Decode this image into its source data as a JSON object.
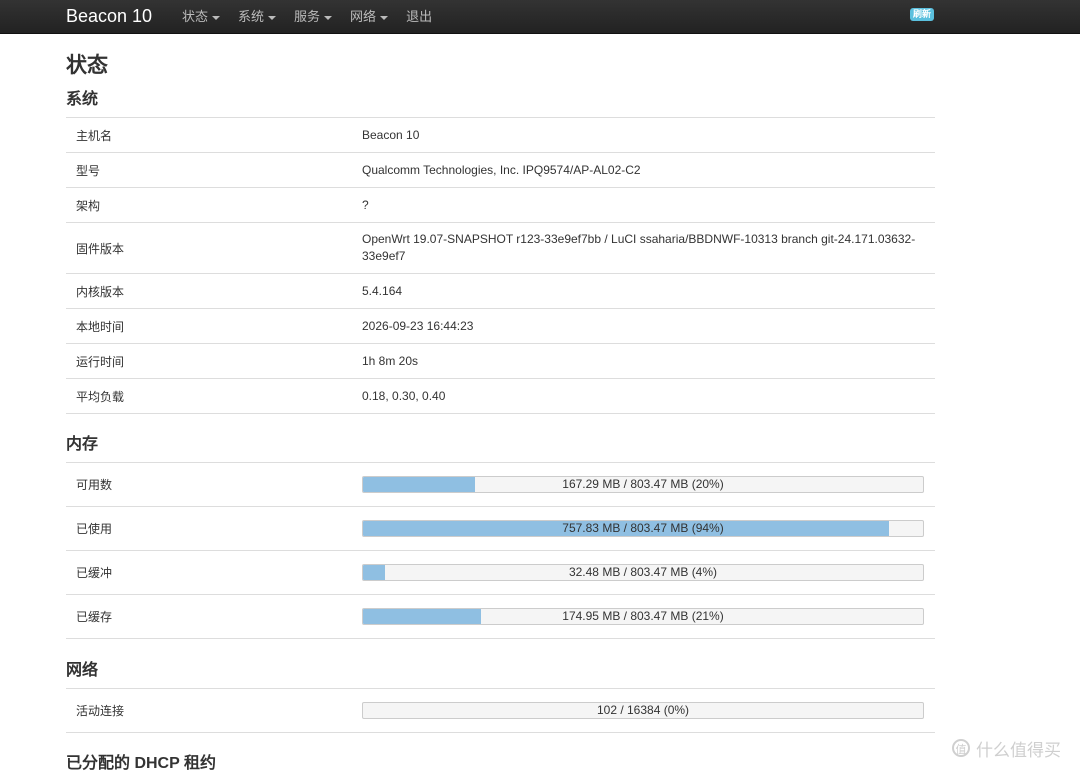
{
  "navbar": {
    "brand": "Beacon 10",
    "menu": [
      {
        "label": "状态",
        "dropdown": true
      },
      {
        "label": "系统",
        "dropdown": true
      },
      {
        "label": "服务",
        "dropdown": true
      },
      {
        "label": "网络",
        "dropdown": true
      },
      {
        "label": "退出",
        "dropdown": false
      }
    ],
    "refresh_badge": "刷新"
  },
  "page_title": "状态",
  "system": {
    "title": "系统",
    "rows": [
      {
        "label": "主机名",
        "value": "Beacon 10"
      },
      {
        "label": "型号",
        "value": "Qualcomm Technologies, Inc. IPQ9574/AP-AL02-C2"
      },
      {
        "label": "架构",
        "value": "?"
      },
      {
        "label": "固件版本",
        "value": "OpenWrt 19.07-SNAPSHOT r123-33e9ef7bb / LuCI ssaharia/BBDNWF-10313 branch git-24.171.03632-33e9ef7"
      },
      {
        "label": "内核版本",
        "value": "5.4.164"
      },
      {
        "label": "本地时间",
        "value": "2026-09-23 16:44:23"
      },
      {
        "label": "运行时间",
        "value": "1h 8m 20s"
      },
      {
        "label": "平均负载",
        "value": "0.18, 0.30, 0.40"
      }
    ]
  },
  "memory": {
    "title": "内存",
    "rows": [
      {
        "label": "可用数",
        "text": "167.29 MB / 803.47 MB (20%)",
        "fraction": 0.2
      },
      {
        "label": "已使用",
        "text": "757.83 MB / 803.47 MB (94%)",
        "fraction": 0.94
      },
      {
        "label": "已缓冲",
        "text": "32.48 MB / 803.47 MB (4%)",
        "fraction": 0.04
      },
      {
        "label": "已缓存",
        "text": "174.95 MB / 803.47 MB (21%)",
        "fraction": 0.21
      }
    ]
  },
  "network": {
    "title": "网络",
    "rows": [
      {
        "label": "活动连接",
        "text": "102 / 16384 (0%)",
        "fraction": 0.0
      }
    ]
  },
  "dhcp": {
    "title": "已分配的 DHCP 租约"
  },
  "watermark": {
    "text": "什么值得买",
    "icon_glyph": "值"
  },
  "colors": {
    "navbar": "#222222",
    "progress_fill": "#8fbfe2",
    "badge": "#5bc0de"
  }
}
